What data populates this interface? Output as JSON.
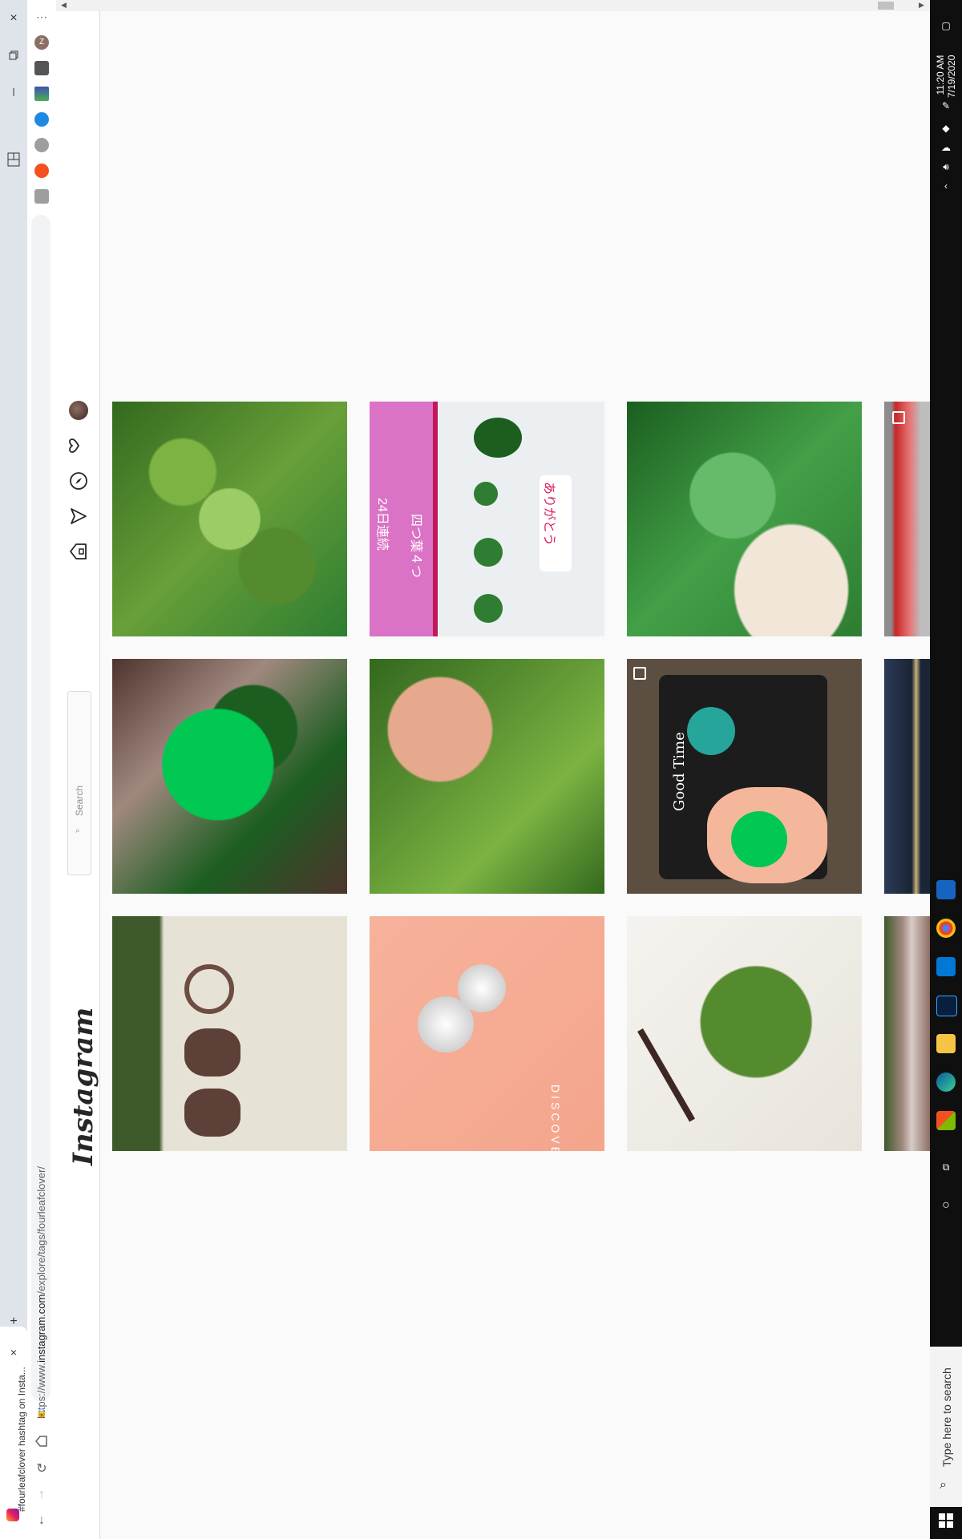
{
  "browser": {
    "tab_title": "#fourleafclover hashtag on Insta...",
    "url_prefix": "https://www.",
    "url_host": "instagram.com",
    "url_path": "/explore/tags/fourleafclover/",
    "new_tab_symbol": "+",
    "close_symbol": "×",
    "more_symbol": "⋯",
    "avatar_letter": "Z"
  },
  "instagram": {
    "logo_text": "Instagram",
    "search_placeholder": "Search"
  },
  "posts": [
    {
      "description": "four-leaf clover in grass with dew",
      "multi": false
    },
    {
      "description": "pink card with four clovers, 24日連続 四つ葉4つ ありがとう",
      "multi": false
    },
    {
      "description": "hand holding large four-leaf clover",
      "multi": false
    },
    {
      "description": "red mushroom cap",
      "multi": true
    },
    {
      "description": "shiny green clover sculpture",
      "multi": false
    },
    {
      "description": "hand picking clover in grass",
      "multi": false
    },
    {
      "description": "clover keychain charms on black wallet, Good Time",
      "multi": true
    },
    {
      "description": "dark blue object",
      "multi": false
    },
    {
      "description": "copper jewelry pendants on white",
      "multi": false
    },
    {
      "description": "silver clover brooch on peach background, DISCOVER",
      "multi": false
    },
    {
      "description": "watercolor painting of four-leaf clover with brush",
      "multi": false
    },
    {
      "description": "bracket fungus on log",
      "multi": false
    }
  ],
  "post_texts": {
    "jp_streak": "24日連続",
    "jp_four": "四つ葉４つ",
    "jp_thanks": "ありがとう",
    "good_time": "Good Time",
    "discover": "DISCOVER"
  },
  "taskbar": {
    "time": "11:20 AM",
    "date": "7/19/2020",
    "search_placeholder": "Type here to search"
  },
  "colors": {
    "instagram_bg": "#fafafa",
    "taskbar_bg": "#0f0f0f",
    "tabstrip_bg": "#dfe3ea"
  }
}
